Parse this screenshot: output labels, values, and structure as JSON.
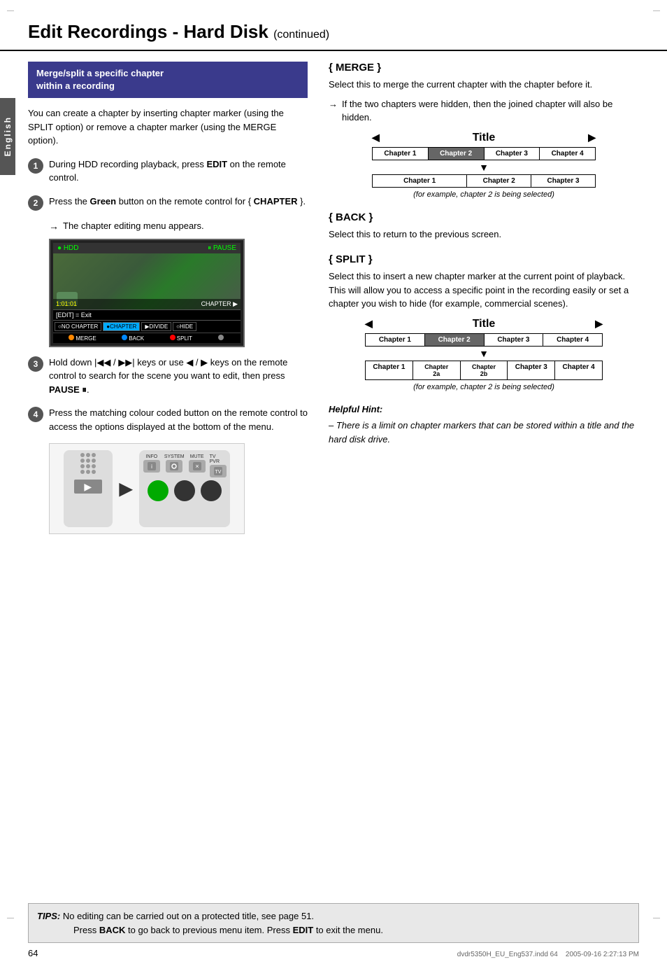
{
  "page": {
    "title": "Edit Recordings - Hard Disk",
    "continued": "(continued)",
    "page_number": "64",
    "footer": "dvdr5350H_EU_Eng537.indd  64",
    "footer_date": "2005-09-16  2:27:13 PM"
  },
  "side_tab": {
    "label": "English"
  },
  "left_col": {
    "section_box": {
      "line1": "Merge/split a specific chapter",
      "line2": "within a recording"
    },
    "intro": "You can create a chapter by inserting chapter marker (using the SPLIT option) or remove a chapter marker (using the MERGE option).",
    "steps": [
      {
        "num": "1",
        "text": "During HDD recording playback, press ",
        "bold": "EDIT",
        "text2": " on the remote control."
      },
      {
        "num": "2",
        "text": "Press the ",
        "bold": "Green",
        "text2": " button on the remote control for { ",
        "bold2": "CHAPTER",
        "text3": " }."
      }
    ],
    "step2_arrow": "The chapter editing menu appears.",
    "hdd": {
      "top_left": "● HDD",
      "top_right": "⏸ PAUSE",
      "timecode": "1:01:01",
      "controls_label": "CHAPTER ▶",
      "bottom_label": "[EDIT] = Exit",
      "menu_items": [
        "○NO CHAPTER",
        "●CHAPTER",
        "▶DIVIDE",
        "○HIDE"
      ],
      "merge_items": [
        "○MERGE",
        "○BACK",
        "●SPLIT",
        "○"
      ]
    },
    "step3": {
      "num": "3",
      "text": "Hold down |◀◀ / ▶▶| keys or use ◀ / ▶ keys on the remote control to search for the scene you want to edit, then press ",
      "bold": "PAUSE ⏸"
    },
    "step4": {
      "num": "4",
      "text": "Press the matching colour coded button on the remote control to access the options displayed at the bottom of the menu."
    }
  },
  "right_col": {
    "merge_section": {
      "heading": "{ MERGE }",
      "desc1": "Select this to merge the current chapter with the chapter before it.",
      "arrow_note": "If the two chapters were hidden, then the joined chapter will also be hidden.",
      "diagram": {
        "title": "Title",
        "top_chapters": [
          "Chapter 1",
          "Chapter 2",
          "Chapter 3",
          "Chapter 4"
        ],
        "highlight_index": 1,
        "bottom_left": "Chapter 1",
        "bottom_right_cells": [
          "Chapter 2",
          "Chapter 3"
        ]
      },
      "caption": "(for example, chapter 2 is being selected)"
    },
    "back_section": {
      "heading": "{ BACK }",
      "desc": "Select this to return to the previous screen."
    },
    "split_section": {
      "heading": "{ SPLIT }",
      "desc": "Select this to insert a new chapter marker at the current point of playback. This will allow you to access a specific point in the recording easily or set a chapter you wish to hide (for example, commercial scenes).",
      "diagram": {
        "title": "Title",
        "top_chapters": [
          "Chapter 1",
          "Chapter 2",
          "Chapter 3",
          "Chapter 4"
        ],
        "highlight_index": 1,
        "bottom_cells": [
          "Chapter 1",
          "Chapter\n2a",
          "Chapter\n2b",
          "Chapter 3",
          "Chapter 4"
        ]
      },
      "caption": "(for example, chapter 2 is being selected)"
    },
    "helpful_hint": {
      "title": "Helpful Hint:",
      "text": "– There is a limit on chapter markers that can be stored within a title and the hard disk drive."
    }
  },
  "tips_box": {
    "label": "TIPS:",
    "line1": "No editing can be carried out on a protected title, see page 51.",
    "line2": "Press ",
    "back_bold": "BACK",
    "line2b": " to go back to previous menu item. Press ",
    "edit_bold": "EDIT",
    "line2c": " to exit the menu."
  }
}
